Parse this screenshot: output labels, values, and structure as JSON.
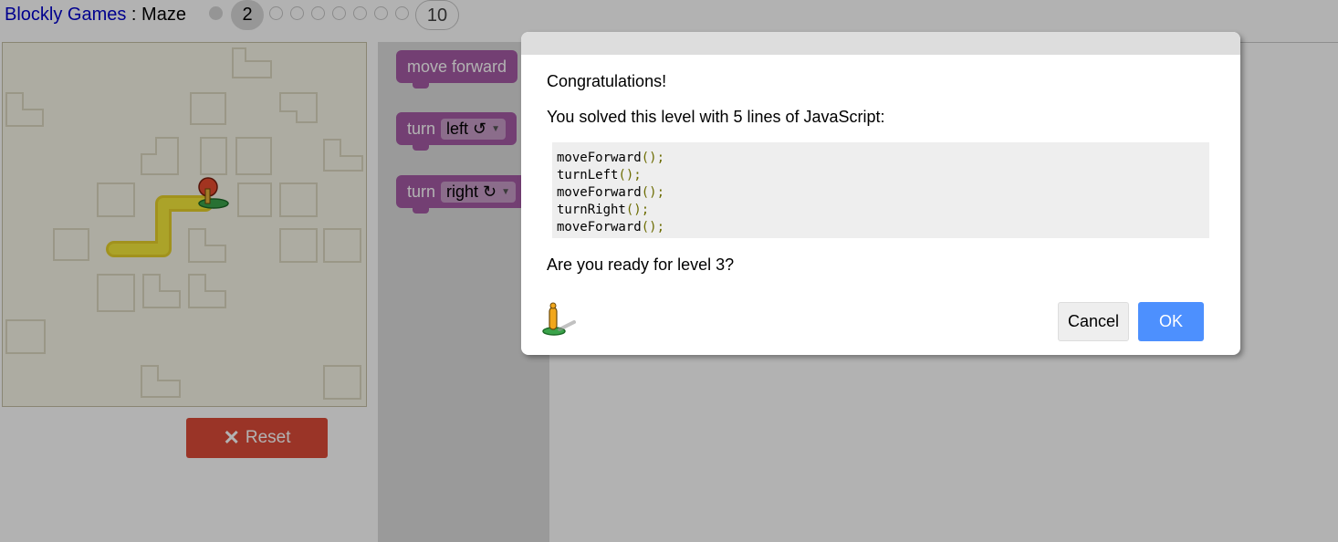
{
  "header": {
    "games_link": "Blockly Games",
    "separator": " : ",
    "game_name": "Maze",
    "levels": {
      "current": "2",
      "last": "10",
      "completed": [
        1
      ]
    }
  },
  "toolbox": {
    "blocks": [
      {
        "label": "move forward"
      },
      {
        "label": "turn",
        "option": "left ↺"
      },
      {
        "label": "turn",
        "option": "right ↻"
      }
    ]
  },
  "maze": {
    "reset_label": "Reset"
  },
  "dialog": {
    "heading": "Congratulations!",
    "message": "You solved this level with 5 lines of JavaScript:",
    "code_lines": [
      {
        "fn": "moveForward",
        "punc": "();"
      },
      {
        "fn": "turnLeft",
        "punc": "();"
      },
      {
        "fn": "moveForward",
        "punc": "();"
      },
      {
        "fn": "turnRight",
        "punc": "();"
      },
      {
        "fn": "moveForward",
        "punc": "();"
      }
    ],
    "question": "Are you ready for level 3?",
    "cancel_label": "Cancel",
    "ok_label": "OK"
  },
  "colors": {
    "link": "#0000cc",
    "block": "#a55ba5",
    "reset": "#dd4b39",
    "ok": "#4d90fe",
    "path": "#f2e20a"
  }
}
